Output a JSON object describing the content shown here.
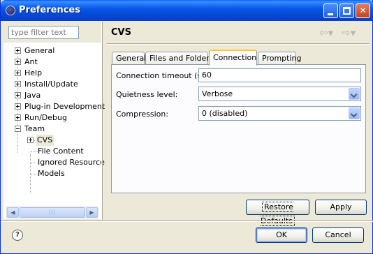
{
  "window": {
    "title": "Preferences"
  },
  "filter": {
    "placeholder": "type filter text"
  },
  "tree": {
    "items": [
      {
        "label": "General"
      },
      {
        "label": "Ant"
      },
      {
        "label": "Help"
      },
      {
        "label": "Install/Update"
      },
      {
        "label": "Java"
      },
      {
        "label": "Plug-in Development"
      },
      {
        "label": "Run/Debug"
      },
      {
        "label": "Team"
      },
      {
        "label": "CVS"
      },
      {
        "label": "File Content"
      },
      {
        "label": "Ignored Resource"
      },
      {
        "label": "Models"
      }
    ],
    "selected": "CVS"
  },
  "page": {
    "title": "CVS"
  },
  "tabs": [
    {
      "label": "General"
    },
    {
      "label": "Files and Folders"
    },
    {
      "label": "Connection"
    },
    {
      "label": "Prompting"
    }
  ],
  "active_tab": "Connection",
  "form": {
    "timeout_label": "Connection timeout (s):",
    "timeout_value": "60",
    "quietness_label": "Quietness level:",
    "quietness_value": "Verbose",
    "compression_label": "Compression:",
    "compression_value": "0 (disabled)"
  },
  "buttons": {
    "restore_defaults": "Restore Defaults",
    "apply": "Apply",
    "ok": "OK",
    "cancel": "Cancel"
  },
  "colors": {
    "titlebar": "#0a4fd8",
    "active_tab_accent": "#ffc83c",
    "close_button": "#c24420"
  }
}
